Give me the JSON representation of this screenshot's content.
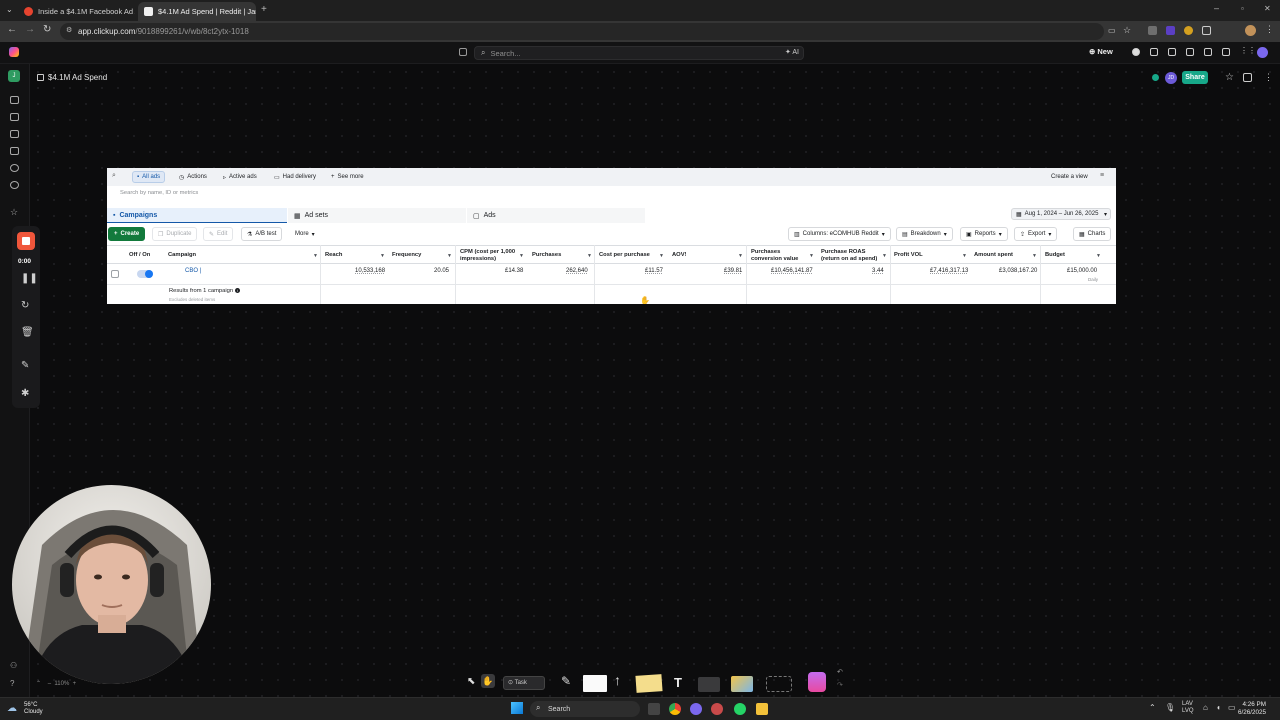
{
  "browser": {
    "tabs": [
      {
        "title": "Inside a $4.1M Facebook Ad A...",
        "active": false
      },
      {
        "title": "$4.1M Ad Spend | Reddit | Janie",
        "active": true
      }
    ],
    "url_host": "app.clickup.com",
    "url_path": "/9018899261/v/wb/8ct2ytx-1018"
  },
  "clickup": {
    "search_placeholder": "Search...",
    "ai_label": "AI",
    "new_label": "New",
    "doc_title": "$4.1M Ad Spend",
    "share_label": "Share",
    "avatar_initials": "JD",
    "zoom_level": "110%"
  },
  "recorder": {
    "time": "0:00"
  },
  "ads_manager": {
    "filters": [
      {
        "label": "All ads",
        "selected": true
      },
      {
        "label": "Actions"
      },
      {
        "label": "Active ads"
      },
      {
        "label": "Had delivery"
      },
      {
        "label": "See more"
      }
    ],
    "create_view": "Create a view",
    "search_placeholder": "Search by name, ID or metrics",
    "tabs": [
      "Campaigns",
      "Ad sets",
      "Ads"
    ],
    "date_range": "Aug 1, 2024 – Jun 26, 2025",
    "toolbar": {
      "create": "Create",
      "duplicate": "Duplicate",
      "edit": "Edit",
      "ab_test": "A/B test",
      "more": "More",
      "columns": "Columns: eCOMHUB Reddit",
      "breakdown": "Breakdown",
      "reports": "Reports",
      "export": "Export",
      "charts": "Charts"
    },
    "columns": {
      "off_on": "Off / On",
      "campaign": "Campaign",
      "reach": "Reach",
      "frequency": "Frequency",
      "cpm_1": "CPM (cost per 1,000",
      "cpm_2": "impressions)",
      "purchases": "Purchases",
      "cost_per_purchase": "Cost per purchase",
      "aov": "AOV!",
      "pcv_1": "Purchases",
      "pcv_2": "conversion value",
      "roas_1": "Purchase ROAS",
      "roas_2": "(return on ad spend)",
      "profit": "Profit VOL",
      "amount_spent": "Amount spent",
      "budget": "Budget"
    },
    "row": {
      "campaign": "CBO |",
      "reach": "10,533,168",
      "frequency": "20.05",
      "cpm": "£14.38",
      "purchases": "262,640",
      "cost_per_purchase": "£11.57",
      "aov": "£39.81",
      "conversion_value": "£10,456,141.87",
      "roas": "3.44",
      "profit": "£7,416,317.13",
      "amount_spent": "£3,038,167.20",
      "budget": "£15,000.00",
      "budget_period": "Daily"
    },
    "results_text": "Results from 1 campaign",
    "excludes_text": "Excludes deleted items"
  },
  "whiteboard_tools": {
    "task_label": "Task"
  },
  "taskbar": {
    "weather_temp": "56°C",
    "weather_desc": "Cloudy",
    "search_label": "Search",
    "lang_1": "LAV",
    "lang_2": "LVQ",
    "time": "4:26 PM",
    "date": "6/26/2025"
  }
}
